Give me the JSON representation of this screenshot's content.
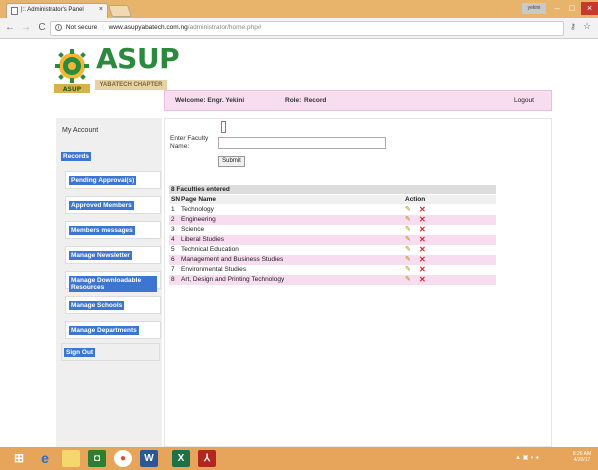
{
  "browser": {
    "tab_title": "|:: Administrator's Panel",
    "tab_close": "×",
    "user_badge": "yekini",
    "minimize": "–",
    "maximize": "□",
    "close": "×",
    "security_label": "Not secure",
    "url_host": "www.asupyabatech.com.ng",
    "url_path": "/administrator/home.php#",
    "info_glyph": "i"
  },
  "logo": {
    "title": "ASUP",
    "subtitle": "YABATECH CHAPTER"
  },
  "header": {
    "welcome": "Welcome: Engr. Yekini",
    "role_label": "Role:",
    "role_value": "Record",
    "logout": "Logout"
  },
  "sidebar": {
    "account": "My Account",
    "records": "Records",
    "items": [
      {
        "label": "Pending Approval(s)"
      },
      {
        "label": "Approved Members"
      },
      {
        "label": "Members messages"
      },
      {
        "label": "Manage Newsletter"
      },
      {
        "label": "Manage Downloadable Resources"
      },
      {
        "label": "Manage Schools"
      },
      {
        "label": "Manage Departments"
      }
    ],
    "sign_out": "Sign Out"
  },
  "form": {
    "label": "Enter Faculty Name:",
    "value": "",
    "submit": "Submit"
  },
  "table": {
    "count_label": "8 Faculties entered",
    "headers": {
      "sn": "SN",
      "name": "Page Name",
      "action": "Action"
    },
    "rows": [
      {
        "sn": "1",
        "name": "Technology"
      },
      {
        "sn": "2",
        "name": "Engineering"
      },
      {
        "sn": "3",
        "name": "Science"
      },
      {
        "sn": "4",
        "name": "Liberal Studies"
      },
      {
        "sn": "5",
        "name": "Technical Education"
      },
      {
        "sn": "6",
        "name": "Management and Business Studies"
      },
      {
        "sn": "7",
        "name": "Environmental Studies"
      },
      {
        "sn": "8",
        "name": "Art, Design and Printing Technology"
      }
    ],
    "edit_glyph": "✎",
    "delete_glyph": "✕"
  },
  "taskbar": {
    "tray_text": "▲ ▣ ◖ ◂",
    "time": "8:26 AM",
    "date": "4/20/17"
  },
  "colors": {
    "title_bar": "#e8b36b",
    "taskbar": "#e7a45b",
    "accent_pink": "#f7ddef",
    "menu_blue": "#3d76d1",
    "brand_green": "#2b8a3e"
  }
}
